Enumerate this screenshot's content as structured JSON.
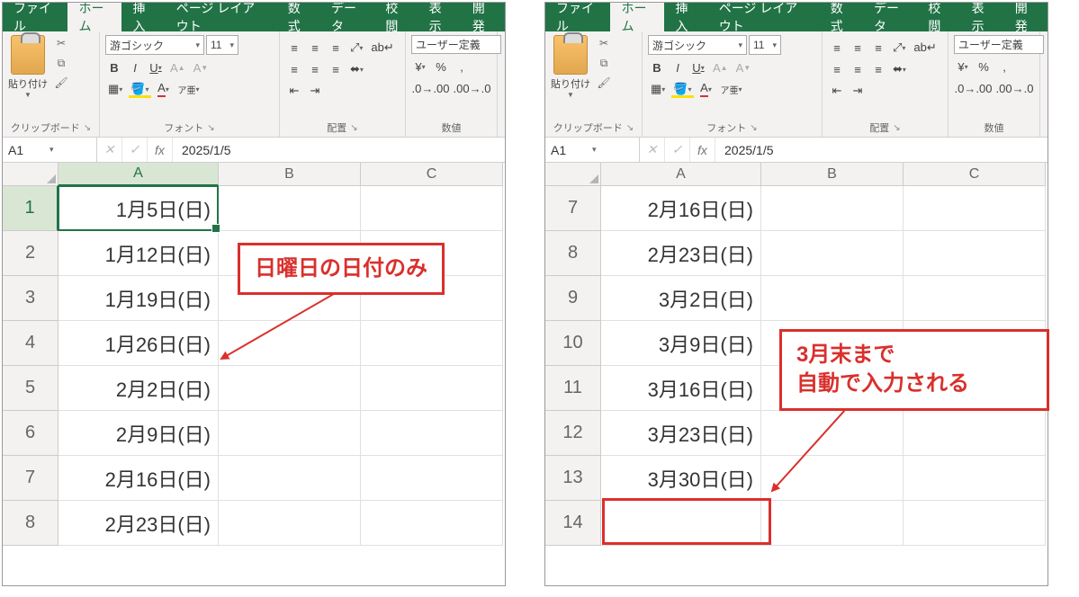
{
  "tabs": [
    "ファイル",
    "ホーム",
    "挿入",
    "ページ レイアウト",
    "数式",
    "データ",
    "校閲",
    "表示",
    "開発"
  ],
  "active_tab": "ホーム",
  "ribbon": {
    "clipboard_label": "クリップボード",
    "paste_label": "貼り付け",
    "font_label": "フォント",
    "font_name": "游ゴシック",
    "font_size": "11",
    "align_label": "配置",
    "wrap_label": "",
    "number_label": "数値",
    "number_format": "ユーザー定義"
  },
  "left": {
    "namebox": "A1",
    "formula": "2025/1/5",
    "sel_col": "A",
    "sel_row": "1",
    "cols": [
      "A",
      "B",
      "C"
    ],
    "rows": [
      {
        "n": "1",
        "v": "1月5日(日)"
      },
      {
        "n": "2",
        "v": "1月12日(日)"
      },
      {
        "n": "3",
        "v": "1月19日(日)"
      },
      {
        "n": "4",
        "v": "1月26日(日)"
      },
      {
        "n": "5",
        "v": "2月2日(日)"
      },
      {
        "n": "6",
        "v": "2月9日(日)"
      },
      {
        "n": "7",
        "v": "2月16日(日)"
      },
      {
        "n": "8",
        "v": "2月23日(日)"
      }
    ],
    "callout": "日曜日の日付のみ"
  },
  "right": {
    "namebox": "A1",
    "formula": "2025/1/5",
    "cols": [
      "A",
      "B",
      "C"
    ],
    "rows": [
      {
        "n": "7",
        "v": "2月16日(日)"
      },
      {
        "n": "8",
        "v": "2月23日(日)"
      },
      {
        "n": "9",
        "v": "3月2日(日)"
      },
      {
        "n": "10",
        "v": "3月9日(日)"
      },
      {
        "n": "11",
        "v": "3月16日(日)"
      },
      {
        "n": "12",
        "v": "3月23日(日)"
      },
      {
        "n": "13",
        "v": "3月30日(日)"
      },
      {
        "n": "14",
        "v": ""
      }
    ],
    "callout_line1": "3月末まで",
    "callout_line2": "自動で入力される"
  },
  "icons": {
    "percent": "%",
    "comma": ",",
    "yen": "¥"
  }
}
